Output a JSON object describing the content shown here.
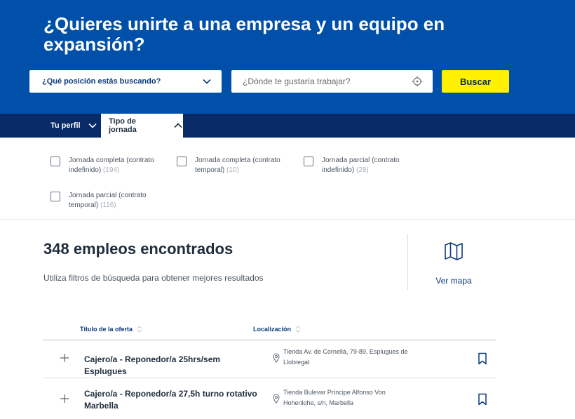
{
  "hero": {
    "title": "¿Quieres unirte a una empresa y un equipo en expansión?"
  },
  "search": {
    "position_label": "¿Qué posición estás buscando?",
    "location_placeholder": "¿Dónde te gustaría trabajar?",
    "button_label": "Buscar"
  },
  "tabs": [
    {
      "label": "Tu perfil",
      "expanded": false
    },
    {
      "label": "Tipo de jornada",
      "expanded": true
    }
  ],
  "filters": [
    {
      "label": "Jornada completa (contrato indefinido)",
      "count": "(194)",
      "checked": false
    },
    {
      "label": "Jornada completa (contrato temporal)",
      "count": "(10)",
      "checked": false
    },
    {
      "label": "Jornada parcial (contrato indefinido)",
      "count": "(28)",
      "checked": false
    },
    {
      "label": "Jornada parcial (contrato temporal)",
      "count": "(116)",
      "checked": false
    }
  ],
  "results": {
    "title": "348 empleos encontrados",
    "hint": "Utiliza filtros de búsqueda para obtener mejores resultados",
    "map_label": "Ver mapa"
  },
  "table": {
    "columns": [
      "Título de la oferta",
      "Localización"
    ],
    "rows": [
      {
        "title": "Cajero/a - Reponedor/a 25hrs/sem Esplugues",
        "location": "Tienda Av. de Cornellà, 79-89, Esplugues de Llobregat"
      },
      {
        "title": "Cajero/a - Reponedor/a 27,5h turno rotativo Marbella",
        "location": "Tienda Bulevar Príncipe Alfonso Von Hohenlohe, s/n, Marbella"
      }
    ]
  },
  "colors": {
    "brand_blue": "#0050aa",
    "nav_navy": "#082a66",
    "accent_yellow": "#fff000"
  },
  "icons": {
    "dropdown": "chevron-down-icon",
    "collapse": "chevron-up-icon",
    "locate": "crosshair-icon",
    "map": "map-icon",
    "sort": "sort-icon",
    "expand": "plus-icon",
    "location": "location-pin-icon",
    "save": "bookmark-icon"
  }
}
